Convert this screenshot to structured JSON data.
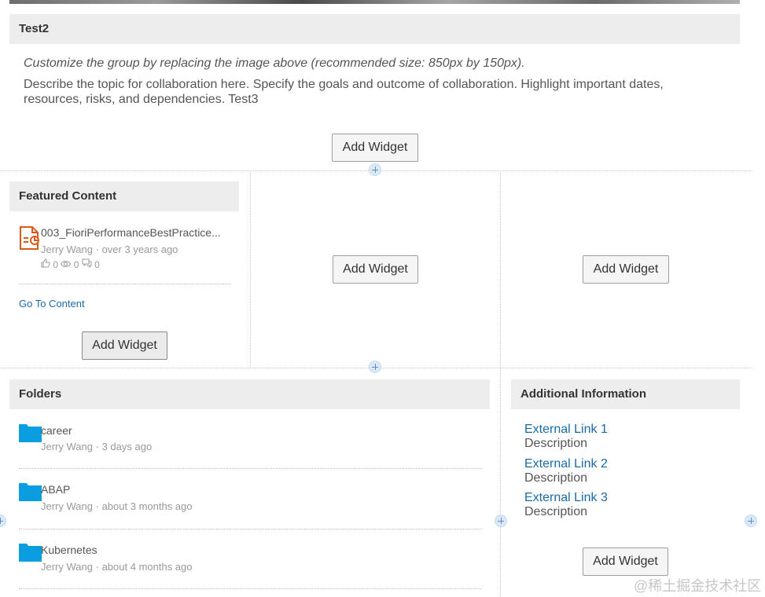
{
  "group": {
    "title": "Test2",
    "customize_hint": "Customize the group by replacing the image above (recommended size: 850px by 150px).",
    "description": "Describe the topic for collaboration here. Specify the goals and outcome of collaboration. Highlight important dates, resources, risks, and dependencies. Test3"
  },
  "add_widget_label": "Add Widget",
  "featured": {
    "title": "Featured Content",
    "item": {
      "name": "003_FioriPerformanceBestPractice...",
      "author": "Jerry Wang",
      "time": "over 3 years ago",
      "likes": "0",
      "views": "0",
      "comments": "0"
    },
    "go_to_content": "Go To Content"
  },
  "folders": {
    "title": "Folders",
    "items": [
      {
        "name": "career",
        "author": "Jerry Wang",
        "time": "3 days ago"
      },
      {
        "name": "ABAP",
        "author": "Jerry Wang",
        "time": "about 3 months ago"
      },
      {
        "name": "Kubernetes",
        "author": "Jerry Wang",
        "time": "about 4 months ago"
      }
    ],
    "separator": "·"
  },
  "additional": {
    "title": "Additional Information",
    "links": [
      {
        "label": "External Link 1",
        "description": "Description"
      },
      {
        "label": "External Link 2",
        "description": "Description"
      },
      {
        "label": "External Link 3",
        "description": "Description"
      }
    ]
  },
  "watermark": "@稀土掘金技术社区",
  "colors": {
    "link": "#1b6aa8",
    "folder": "#0a9ddf",
    "doc_icon": "#d95a1c",
    "header_bg": "#ededed"
  },
  "icons": [
    "presentation-file-icon",
    "thumbs-up-icon",
    "eye-icon",
    "comment-icon",
    "folder-icon",
    "add-section-icon"
  ]
}
